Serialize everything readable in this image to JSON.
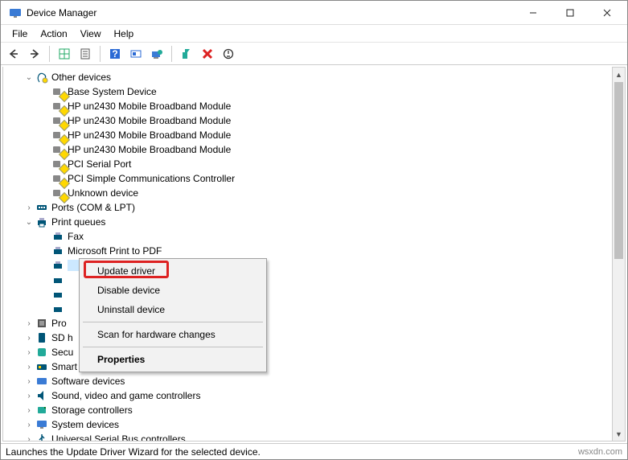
{
  "window": {
    "title": "Device Manager"
  },
  "menus": {
    "file": "File",
    "action": "Action",
    "view": "View",
    "help": "Help"
  },
  "tree": {
    "other_devices": {
      "label": "Other devices",
      "expanded": true
    },
    "items_other": [
      "Base System Device",
      "HP un2430 Mobile Broadband Module",
      "HP un2430 Mobile Broadband Module",
      "HP un2430 Mobile Broadband Module",
      "HP un2430 Mobile Broadband Module",
      "PCI Serial Port",
      "PCI Simple Communications Controller",
      "Unknown device"
    ],
    "ports": {
      "label": "Ports (COM & LPT)"
    },
    "print_queues": {
      "label": "Print queues",
      "expanded": true
    },
    "items_print": [
      "Fax",
      "Microsoft Print to PDF"
    ],
    "processors": {
      "label": "Pro"
    },
    "sdhost": {
      "label": "SD h"
    },
    "security": {
      "label": "Secu"
    },
    "smartcard": {
      "label": "Smart card readers"
    },
    "software": {
      "label": "Software devices"
    },
    "sound": {
      "label": "Sound, video and game controllers"
    },
    "storage": {
      "label": "Storage controllers"
    },
    "system": {
      "label": "System devices"
    },
    "usb": {
      "label": "Universal Serial Bus controllers"
    }
  },
  "context_menu": {
    "update": "Update driver",
    "disable": "Disable device",
    "uninstall": "Uninstall device",
    "scan": "Scan for hardware changes",
    "properties": "Properties"
  },
  "status": {
    "text": "Launches the Update Driver Wizard for the selected device."
  },
  "watermark": "wsxdn.com"
}
